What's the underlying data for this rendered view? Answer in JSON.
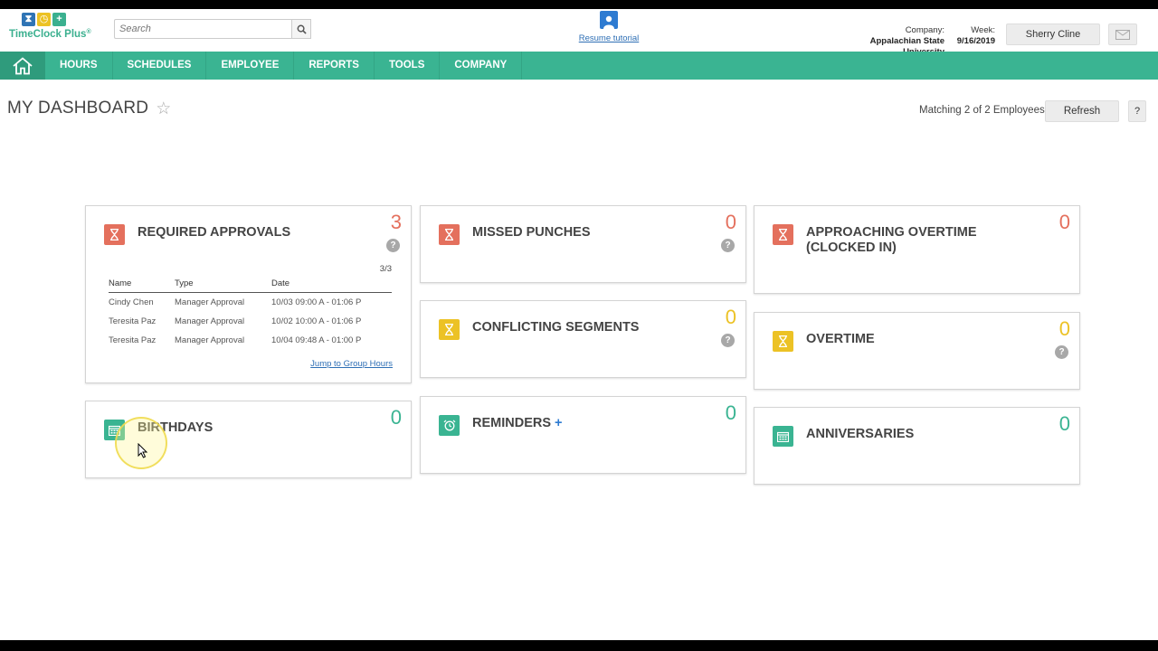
{
  "brand": {
    "logo_text": "TimeClock Plus",
    "logo_mark": "®"
  },
  "search": {
    "placeholder": "Search"
  },
  "tutorial": {
    "label": "Resume tutorial"
  },
  "company": {
    "label": "Company:",
    "value": "Appalachian State University"
  },
  "week": {
    "label": "Week:",
    "value": "9/16/2019"
  },
  "user": {
    "name": "Sherry Cline"
  },
  "nav": [
    "HOURS",
    "SCHEDULES",
    "EMPLOYEE",
    "REPORTS",
    "TOOLS",
    "COMPANY"
  ],
  "page": {
    "title": "MY DASHBOARD",
    "matching": "Matching 2 of 2 Employees",
    "refresh": "Refresh",
    "help": "?"
  },
  "widgets": {
    "required_approvals": {
      "title": "REQUIRED APPROVALS",
      "count": "3",
      "ratio": "3/3",
      "columns": [
        "Name",
        "Type",
        "Date"
      ],
      "rows": [
        [
          "Cindy Chen",
          "Manager Approval",
          "10/03 09:00 A - 01:06 P"
        ],
        [
          "Teresita Paz",
          "Manager Approval",
          "10/02 10:00 A - 01:06 P"
        ],
        [
          "Teresita Paz",
          "Manager Approval",
          "10/04 09:48 A - 01:00 P"
        ]
      ],
      "link": "Jump to Group Hours"
    },
    "missed_punches": {
      "title": "MISSED PUNCHES",
      "count": "0"
    },
    "approaching_overtime": {
      "title_line1": "APPROACHING OVERTIME",
      "title_line2": "(CLOCKED IN)",
      "count": "0"
    },
    "conflicting_segments": {
      "title": "CONFLICTING SEGMENTS",
      "count": "0"
    },
    "overtime": {
      "title": "OVERTIME",
      "count": "0"
    },
    "birthdays": {
      "title": "BIRTHDAYS",
      "count": "0"
    },
    "reminders": {
      "title": "REMINDERS",
      "add": "+",
      "count": "0"
    },
    "anniversaries": {
      "title": "ANNIVERSARIES",
      "count": "0"
    }
  },
  "colors": {
    "nav_green": "#3ab492",
    "alert_red": "#e4705d",
    "warn_yellow": "#ecc225",
    "info_green": "#3ab492",
    "link_blue": "#2e6fb5"
  }
}
